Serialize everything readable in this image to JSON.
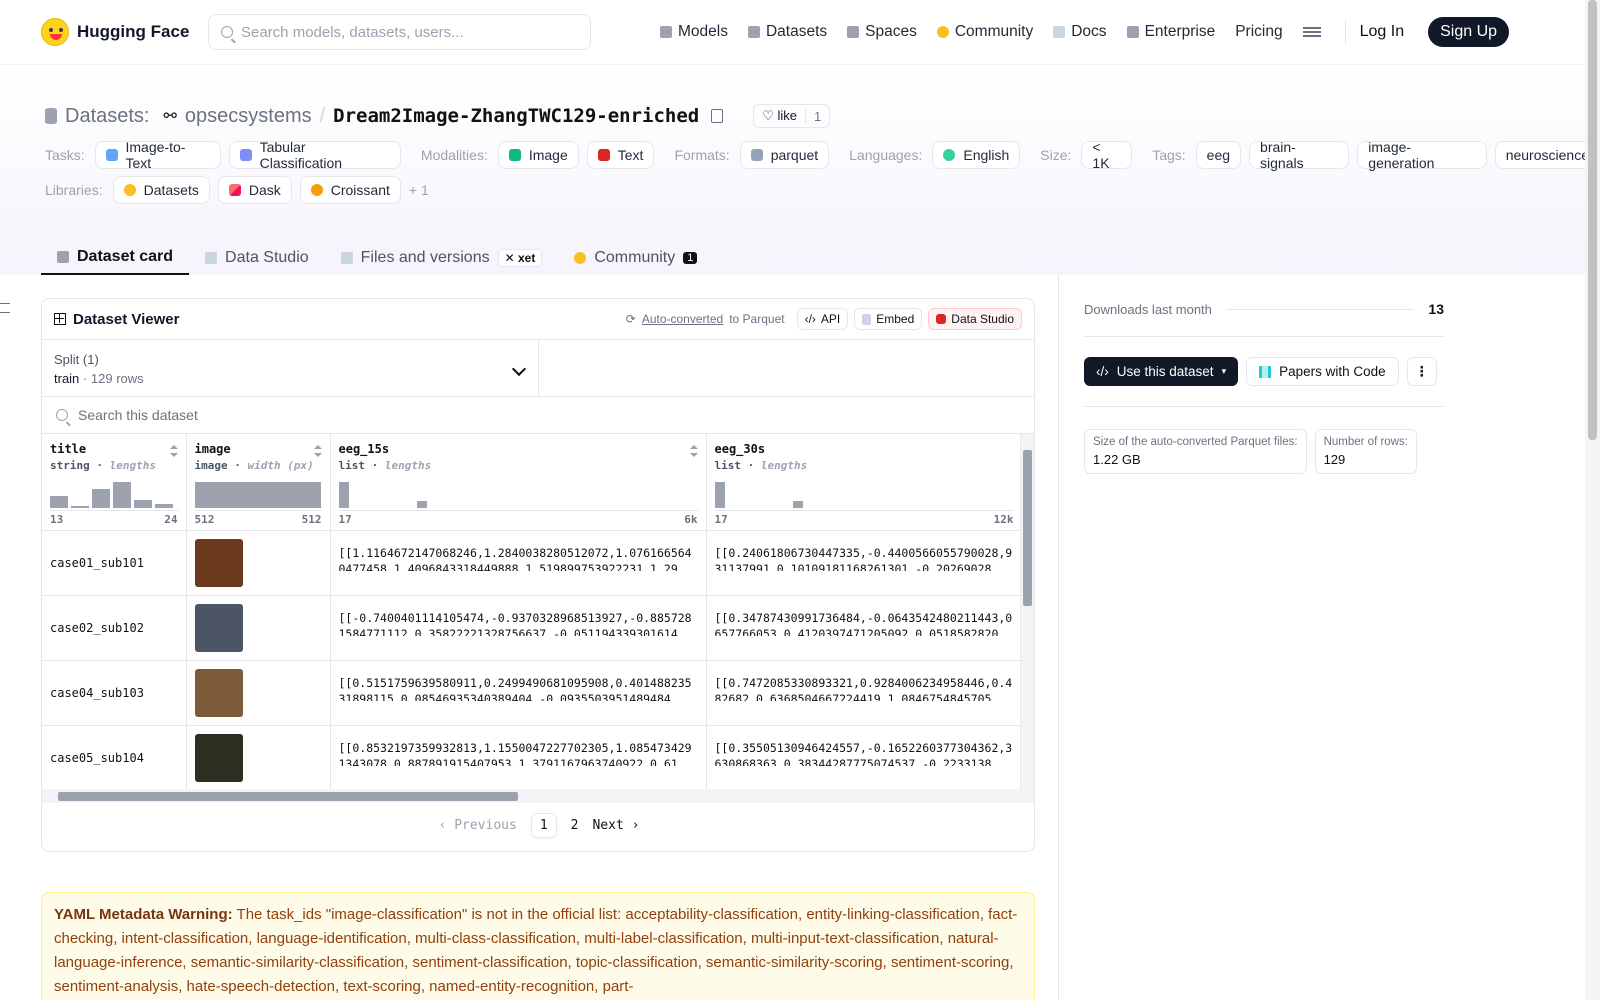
{
  "nav": {
    "brand": "Hugging Face",
    "search_placeholder": "Search models, datasets, users...",
    "links": [
      "Models",
      "Datasets",
      "Spaces",
      "Community",
      "Docs",
      "Enterprise",
      "Pricing"
    ],
    "login": "Log In",
    "signup": "Sign Up"
  },
  "header": {
    "section": "Datasets:",
    "org": "opsecsystems",
    "sep": "/",
    "name": "Dream2Image-ZhangTWC129-enriched",
    "like_label": "like",
    "like_count": "1",
    "tasks_label": "Tasks:",
    "tasks": [
      "Image-to-Text",
      "Tabular Classification"
    ],
    "modalities_label": "Modalities:",
    "modalities": [
      "Image",
      "Text"
    ],
    "formats_label": "Formats:",
    "formats": [
      "parquet"
    ],
    "languages_label": "Languages:",
    "languages": [
      "English"
    ],
    "size_label": "Size:",
    "size": "< 1K",
    "tags_label": "Tags:",
    "tags": [
      "eeg",
      "brain-signals",
      "image-generation",
      "neuroscience"
    ],
    "libraries_label": "Libraries:",
    "libraries": [
      "Datasets",
      "Dask",
      "Croissant"
    ],
    "libraries_more": "+ 1"
  },
  "tabs": {
    "dataset_card": "Dataset card",
    "data_studio": "Data Studio",
    "files": "Files and versions",
    "xet": "xet",
    "community": "Community",
    "community_count": "1"
  },
  "viewer": {
    "title": "Dataset Viewer",
    "auto_converted": "Auto-converted",
    "to_parquet": "to Parquet",
    "api": "API",
    "embed": "Embed",
    "data_studio": "Data Studio",
    "split_label": "Split (1)",
    "split_value": "train",
    "split_rows": "129 rows",
    "search_placeholder": "Search this dataset",
    "columns": [
      {
        "name": "title",
        "type": "string",
        "stat": "lengths",
        "min": "13",
        "max": "24"
      },
      {
        "name": "image",
        "type": "image",
        "stat": "width (px)",
        "min": "512",
        "max": "512"
      },
      {
        "name": "eeg_15s",
        "type": "list",
        "stat": "lengths",
        "min": "17",
        "max": "6k"
      },
      {
        "name": "eeg_30s",
        "type": "list",
        "stat": "lengths",
        "min": "17",
        "max": "12k"
      }
    ],
    "histograms": [
      [
        0.45,
        0.05,
        0.7,
        1.0,
        0.3,
        0.12
      ],
      [
        1.0
      ],
      [
        1.0,
        0,
        0,
        0,
        0,
        0,
        0.25
      ],
      [
        1.0,
        0,
        0,
        0,
        0,
        0,
        0.25
      ]
    ],
    "rows": [
      {
        "title": "case01_sub101",
        "eeg_15s": "[[1.1164672147068246,1.2840038280512072,1.0761665640477458,1.4096843318449888,1.519899753922231,1.29",
        "eeg_30s": "[[0.24061806730447335,-0.4400566055790028,931137991,0.10109181168261301,-0.20269028",
        "thumb": "#6b3a1e"
      },
      {
        "title": "case02_sub102",
        "eeg_15s": "[[-0.7400401114105474,-0.9370328968513927,-0.8857281584771112,0.35822221328756637,-0.051194339301614",
        "eeg_30s": "[[0.34787430991736484,-0.0643542480211443,0657766053,0.4120397471205092,0.0518582820",
        "thumb": "#4b5563"
      },
      {
        "title": "case04_sub103",
        "eeg_15s": "[[0.5151759639580911,0.2499490681095908,0.40148823531898115,0.08546935340389404,-0.0935503951489484,",
        "eeg_30s": "[[0.7472085330893321,0.9284006234958446,0.482682,0.6368504667224419,1.0846754845705,",
        "thumb": "#7c5a3a"
      },
      {
        "title": "case05_sub104",
        "eeg_15s": "[[0.8532197359932813,1.1550047227702305,1.0854734291343078,0.887891915407953,1.3791167963740922,0.61",
        "eeg_30s": "[[0.35505130946424557,-0.1652260377304362,3630868363,0.38344287775074537,-0.2233138",
        "thumb": "#2b2f1f"
      }
    ],
    "more_marker": "(...)",
    "prev": "Previous",
    "next": "Next",
    "pages": [
      "1",
      "2"
    ]
  },
  "warning": {
    "label": "YAML Metadata Warning:",
    "text": "The task_ids \"image-classification\" is not in the official list: acceptability-classification, entity-linking-classification, fact-checking, intent-classification, language-identification, multi-class-classification, multi-label-classification, multi-input-text-classification, natural-language-inference, semantic-similarity-classification, sentiment-classification, topic-classification, semantic-similarity-scoring, sentiment-scoring, sentiment-analysis, hate-speech-detection, text-scoring, named-entity-recognition, part-"
  },
  "sidebar": {
    "downloads_label": "Downloads last month",
    "downloads_value": "13",
    "use_dataset": "Use this dataset",
    "papers_with_code": "Papers with Code",
    "parquet_size_label": "Size of the auto-converted Parquet files:",
    "parquet_size_value": "1.22 GB",
    "rows_label": "Number of rows:",
    "rows_value": "129"
  }
}
